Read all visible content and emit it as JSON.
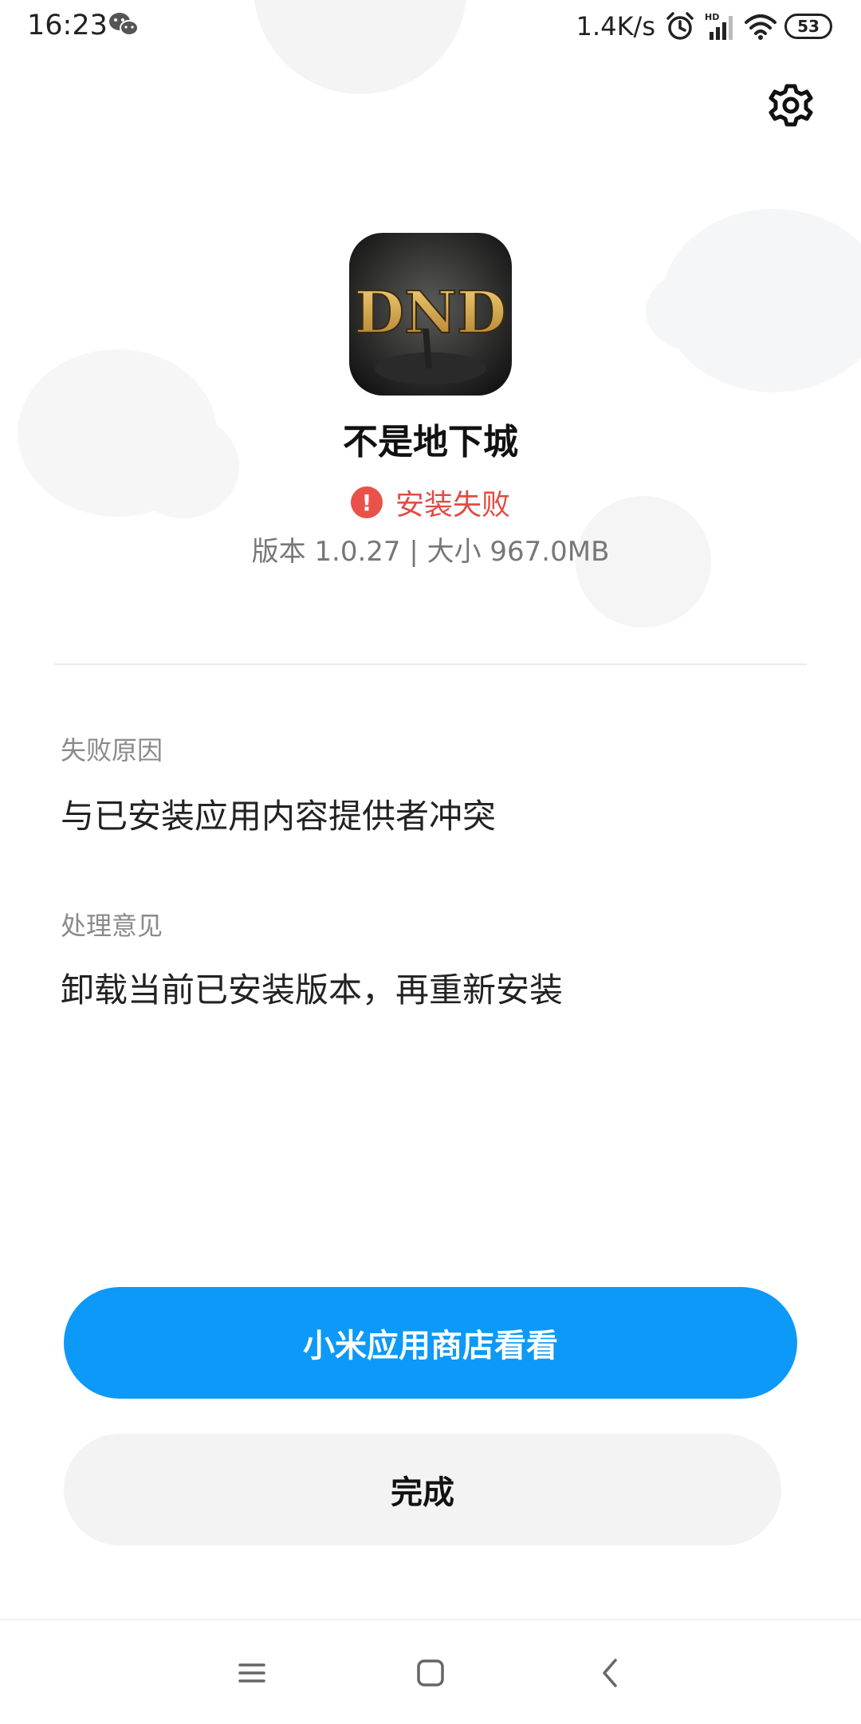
{
  "status_bar": {
    "time": "16:23",
    "network_speed": "1.4K/s",
    "battery": "53",
    "icons": [
      "wechat-icon",
      "alarm-icon",
      "hd-signal-icon",
      "wifi-icon",
      "battery-icon"
    ]
  },
  "app": {
    "name": "不是地下城",
    "icon_text": "DND",
    "status": "安装失败",
    "status_color": "#e04c44",
    "version_line": "版本 1.0.27 | 大小 967.0MB"
  },
  "failure": {
    "reason_label": "失败原因",
    "reason_value": "与已安装应用内容提供者冲突",
    "advice_label": "处理意见",
    "advice_value": "卸载当前已安装版本，再重新安装"
  },
  "buttons": {
    "store_label": "小米应用商店看看",
    "done_label": "完成",
    "primary_color": "#0d99f7"
  },
  "navbar": {
    "icons": [
      "menu-icon",
      "home-icon",
      "back-icon"
    ]
  }
}
